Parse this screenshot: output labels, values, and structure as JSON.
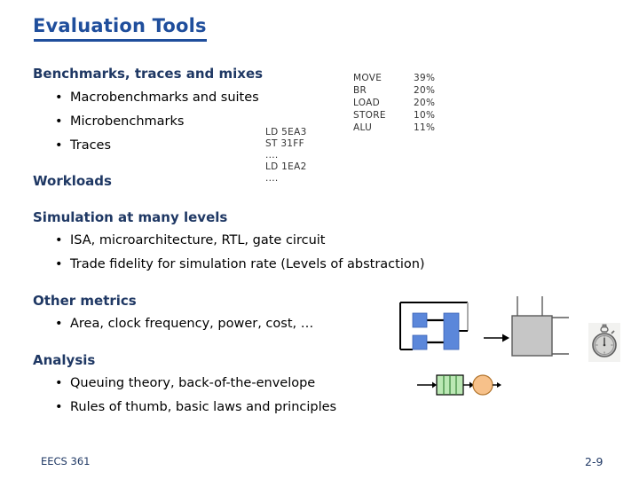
{
  "slide": {
    "title": "Evaluation Tools",
    "sections": [
      {
        "heading": "Benchmarks, traces and mixes",
        "bullets": [
          "Macrobenchmarks and suites",
          "Microbenchmarks",
          "Traces"
        ]
      },
      {
        "heading": "Workloads",
        "bullets": []
      },
      {
        "heading": "Simulation at many levels",
        "bullets": [
          "ISA, microarchitecture, RTL, gate circuit",
          "Trade fidelity for simulation rate (Levels of abstraction)"
        ]
      },
      {
        "heading": "Other metrics",
        "bullets": [
          "Area, clock frequency, power, cost, …"
        ]
      },
      {
        "heading": "Analysis",
        "bullets": [
          "Queuing theory, back-of-the-envelope",
          "Rules of thumb, basic laws and principles"
        ]
      }
    ]
  },
  "instruction_mix": {
    "rows": [
      {
        "op": "MOVE",
        "pct": "39%"
      },
      {
        "op": "BR",
        "pct": "20%"
      },
      {
        "op": "LOAD",
        "pct": "20%"
      },
      {
        "op": "STORE",
        "pct": "10%"
      },
      {
        "op": "ALU",
        "pct": "11%"
      }
    ]
  },
  "trace_sample": {
    "lines": [
      "LD 5EA3",
      "ST 31FF",
      "....",
      "LD 1EA2",
      "...."
    ]
  },
  "figures": {
    "block_diagram_label": "block-diagram",
    "queue_label": "queueing-model",
    "chip_label": "chip-die",
    "stopwatch_label": "stopwatch"
  },
  "footer": {
    "course": "EECS 361",
    "page": "2-9"
  },
  "colors": {
    "title_blue": "#1F4E9C",
    "heading_navy": "#1F3864",
    "body_black": "#000000",
    "block_blue": "#5B87DA",
    "queue_green": "#BBE8B4",
    "server_orange": "#F7C18A",
    "chip_gray": "#C6C6C6"
  }
}
